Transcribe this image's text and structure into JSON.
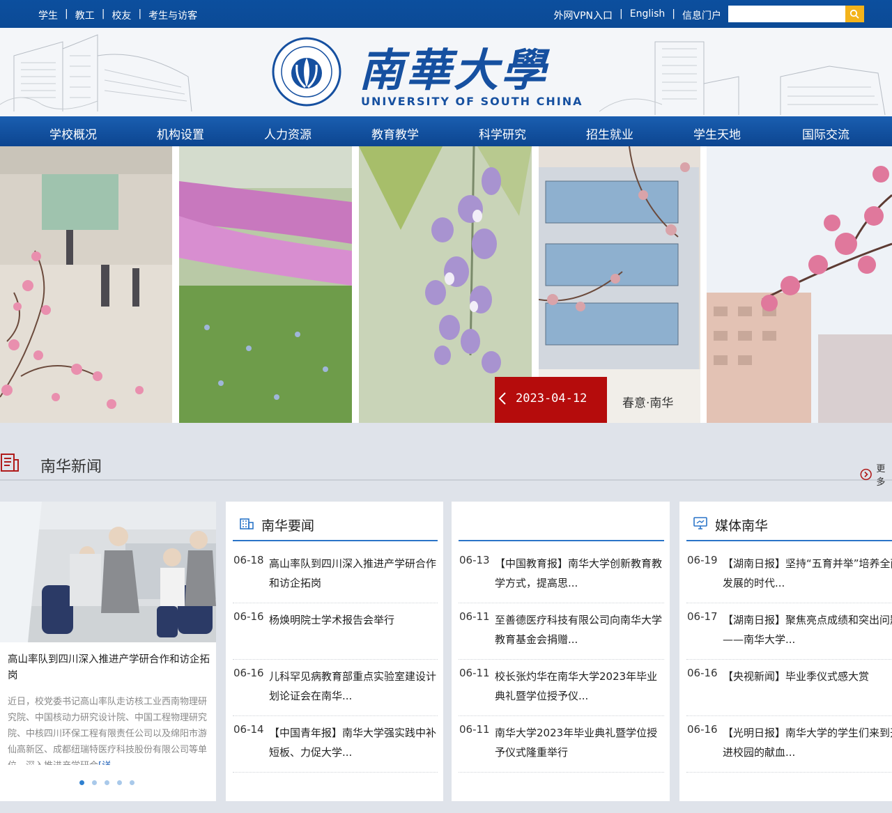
{
  "topbar": {
    "left": [
      "学生",
      "教工",
      "校友",
      "考生与访客"
    ],
    "right": [
      "外网VPN入口",
      "English",
      "信息门户"
    ],
    "search_placeholder": ""
  },
  "header": {
    "logo_cn": "南華大學",
    "logo_en": "UNIVERSITY OF SOUTH CHINA"
  },
  "nav": [
    "学校概况",
    "机构设置",
    "人力资源",
    "教育教学",
    "科学研究",
    "招生就业",
    "学生天地",
    "国际交流"
  ],
  "banner": {
    "date": "2023-04-12",
    "title": "春意·南华"
  },
  "news_section": {
    "title": "南华新闻",
    "more": "更多"
  },
  "featured": {
    "headline": "高山率队到四川深入推进产学研合作和访企拓岗",
    "excerpt": "近日，校党委书记高山率队走访核工业西南物理研究院、中国核动力研究设计院、中国工程物理研究院、中核四川环保工程有限责任公司以及绵阳市游仙高新区、成都纽瑞特医疗科技股份有限公司等单位，深入推进产学研合",
    "detail_link": "[详",
    "dots": 5
  },
  "col_yaowen": {
    "title": "南华要闻",
    "items": [
      {
        "date": "06-18",
        "text": "高山率队到四川深入推进产学研合作和访企拓岗"
      },
      {
        "date": "06-16",
        "text": "杨焕明院士学术报告会举行"
      },
      {
        "date": "06-16",
        "text": "儿科罕见病教育部重点实验室建设计划论证会在南华..."
      },
      {
        "date": "06-14",
        "text": "【中国青年报】南华大学强实践中补短板、力促大学..."
      }
    ]
  },
  "col_middle": {
    "items": [
      {
        "date": "06-13",
        "text": "【中国教育报】南华大学创新教育教学方式，提高思..."
      },
      {
        "date": "06-11",
        "text": "至善德医疗科技有限公司向南华大学教育基金会捐赠..."
      },
      {
        "date": "06-11",
        "text": "校长张灼华在南华大学2023年毕业典礼暨学位授予仪..."
      },
      {
        "date": "06-11",
        "text": "南华大学2023年毕业典礼暨学位授予仪式隆重举行"
      }
    ]
  },
  "col_media": {
    "title": "媒体南华",
    "items": [
      {
        "date": "06-19",
        "text": "【湖南日报】坚持“五育并举”培养全面发展的时代..."
      },
      {
        "date": "06-17",
        "text": "【湖南日报】聚焦亮点成绩和突出问题——南华大学..."
      },
      {
        "date": "06-16",
        "text": "【央视新闻】毕业季仪式感大赏"
      },
      {
        "date": "06-16",
        "text": "【光明日报】南华大学的学生们来到开进校园的献血..."
      }
    ]
  },
  "colors": {
    "brand_blue": "#0c4f9e",
    "accent_red": "#b50c0c",
    "search_btn": "#f3b31b"
  }
}
